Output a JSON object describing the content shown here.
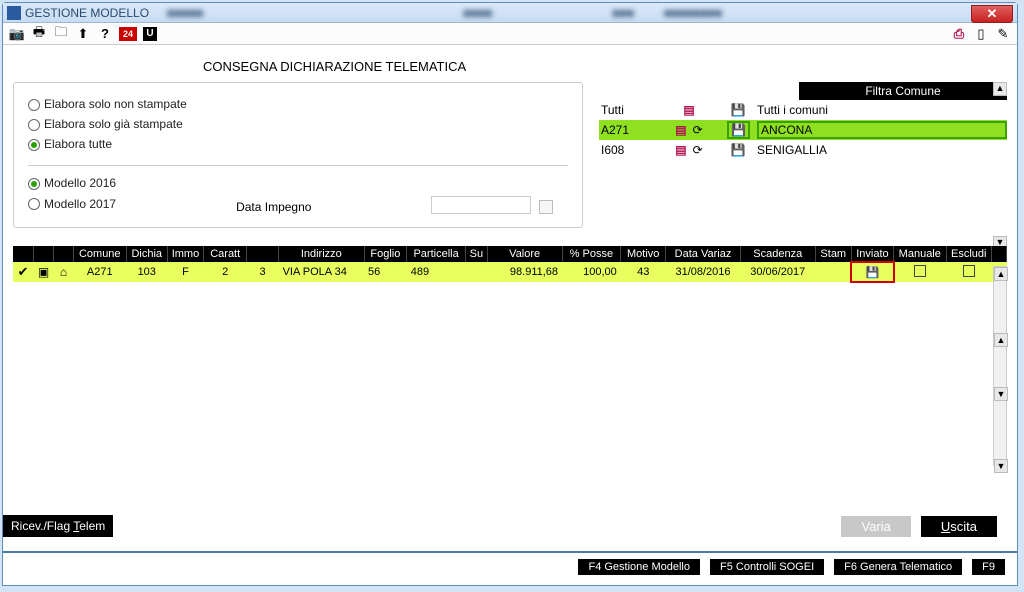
{
  "titlebar": {
    "title": "GESTIONE MODELLO"
  },
  "toolbar": {
    "icon24": "24",
    "iconU": "U"
  },
  "section_title": "CONSEGNA DICHIARAZIONE TELEMATICA",
  "filters": {
    "r1": "Elabora solo non stampate",
    "r2": "Elabora solo già stampate",
    "r3": "Elabora tutte",
    "m1": "Modello 2016",
    "m2": "Modello 2017",
    "date_label": "Data Impegno"
  },
  "comuni": {
    "header": "Filtra Comune",
    "rows": [
      {
        "code": "Tutti",
        "name": "Tutti i comuni",
        "selected": false,
        "hasRefresh": false
      },
      {
        "code": "A271",
        "name": "ANCONA",
        "selected": true,
        "hasRefresh": true
      },
      {
        "code": "I608",
        "name": "SENIGALLIA",
        "selected": false,
        "hasRefresh": true
      }
    ]
  },
  "grid": {
    "headers": {
      "comune": "Comune",
      "dichia": "Dichia",
      "immo": "Immo",
      "caratt": "Caratt",
      "indirizzo": "Indirizzo",
      "foglio": "Foglio",
      "particella": "Particella",
      "su": "Su",
      "valore": "Valore",
      "posse": "% Posse",
      "motivo": "Motivo",
      "datavar": "Data Variaz",
      "scadenza": "Scadenza",
      "stamp": "Stam",
      "inviato": "Inviato",
      "manuale": "Manuale",
      "escludi": "Escludi"
    },
    "row": {
      "comune": "A271",
      "dichia": "103",
      "immo": "F",
      "caratt_n": "2",
      "caratt2": "3",
      "indirizzo": "VIA POLA 34",
      "foglio": "56",
      "particella": "489",
      "valore": "98.911,68",
      "posse": "100,00",
      "motivo": "43",
      "datavar": "31/08/2016",
      "scadenza": "30/06/2017"
    }
  },
  "footer": {
    "left_pre": "Ricev./Flag ",
    "left_u": "T",
    "left_post": "elem",
    "varia": "Varia",
    "uscita_u": "U",
    "uscita_post": "scita"
  },
  "fkeys": {
    "f4": "F4 Gestione Modello",
    "f5": "F5 Controlli SOGEI",
    "f6": "F6 Genera Telematico",
    "f9": "F9"
  }
}
